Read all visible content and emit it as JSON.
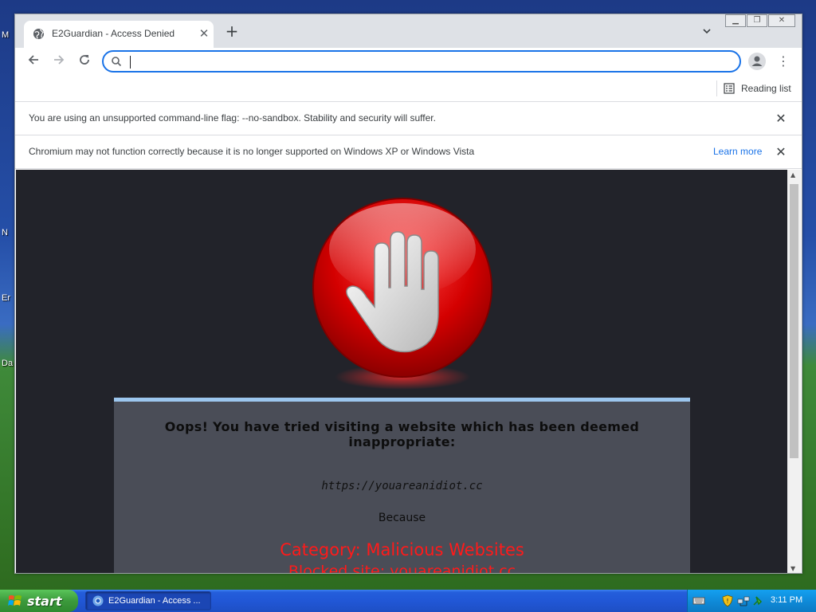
{
  "desktop": {
    "icon_labels": [
      "M",
      "N",
      "Er",
      "Da"
    ]
  },
  "browser": {
    "tab": {
      "title": "E2Guardian - Access Denied",
      "favicon": "globe-icon"
    },
    "window_controls": [
      "minimize",
      "restore",
      "close"
    ],
    "omnibox": {
      "value": "",
      "icon": "search-icon"
    },
    "bookmark_bar": {
      "reading_list_label": "Reading list"
    },
    "infobars": [
      {
        "text": "You are using an unsupported command-line flag: --no-sandbox. Stability and security will suffer."
      },
      {
        "text": "Chromium may not function correctly because it is no longer supported on Windows XP or Windows Vista",
        "link": "Learn more"
      }
    ]
  },
  "page": {
    "heading": "Oops! You have tried visiting a website which has been deemed inappropriate:",
    "url": "https://youareanidiot.cc",
    "because": "Because",
    "category": "Category: Malicious Websites",
    "blocked_site": "Blocked site: youareanidiot.cc",
    "colors": {
      "background": "#22232a",
      "panel": "#4a4d57",
      "panel_accent": "#9cc6ee",
      "alert_red": "#ff1a1a"
    }
  },
  "taskbar": {
    "start_label": "start",
    "task_item": "E2Guardian - Access ...",
    "clock": "3:11 PM"
  }
}
